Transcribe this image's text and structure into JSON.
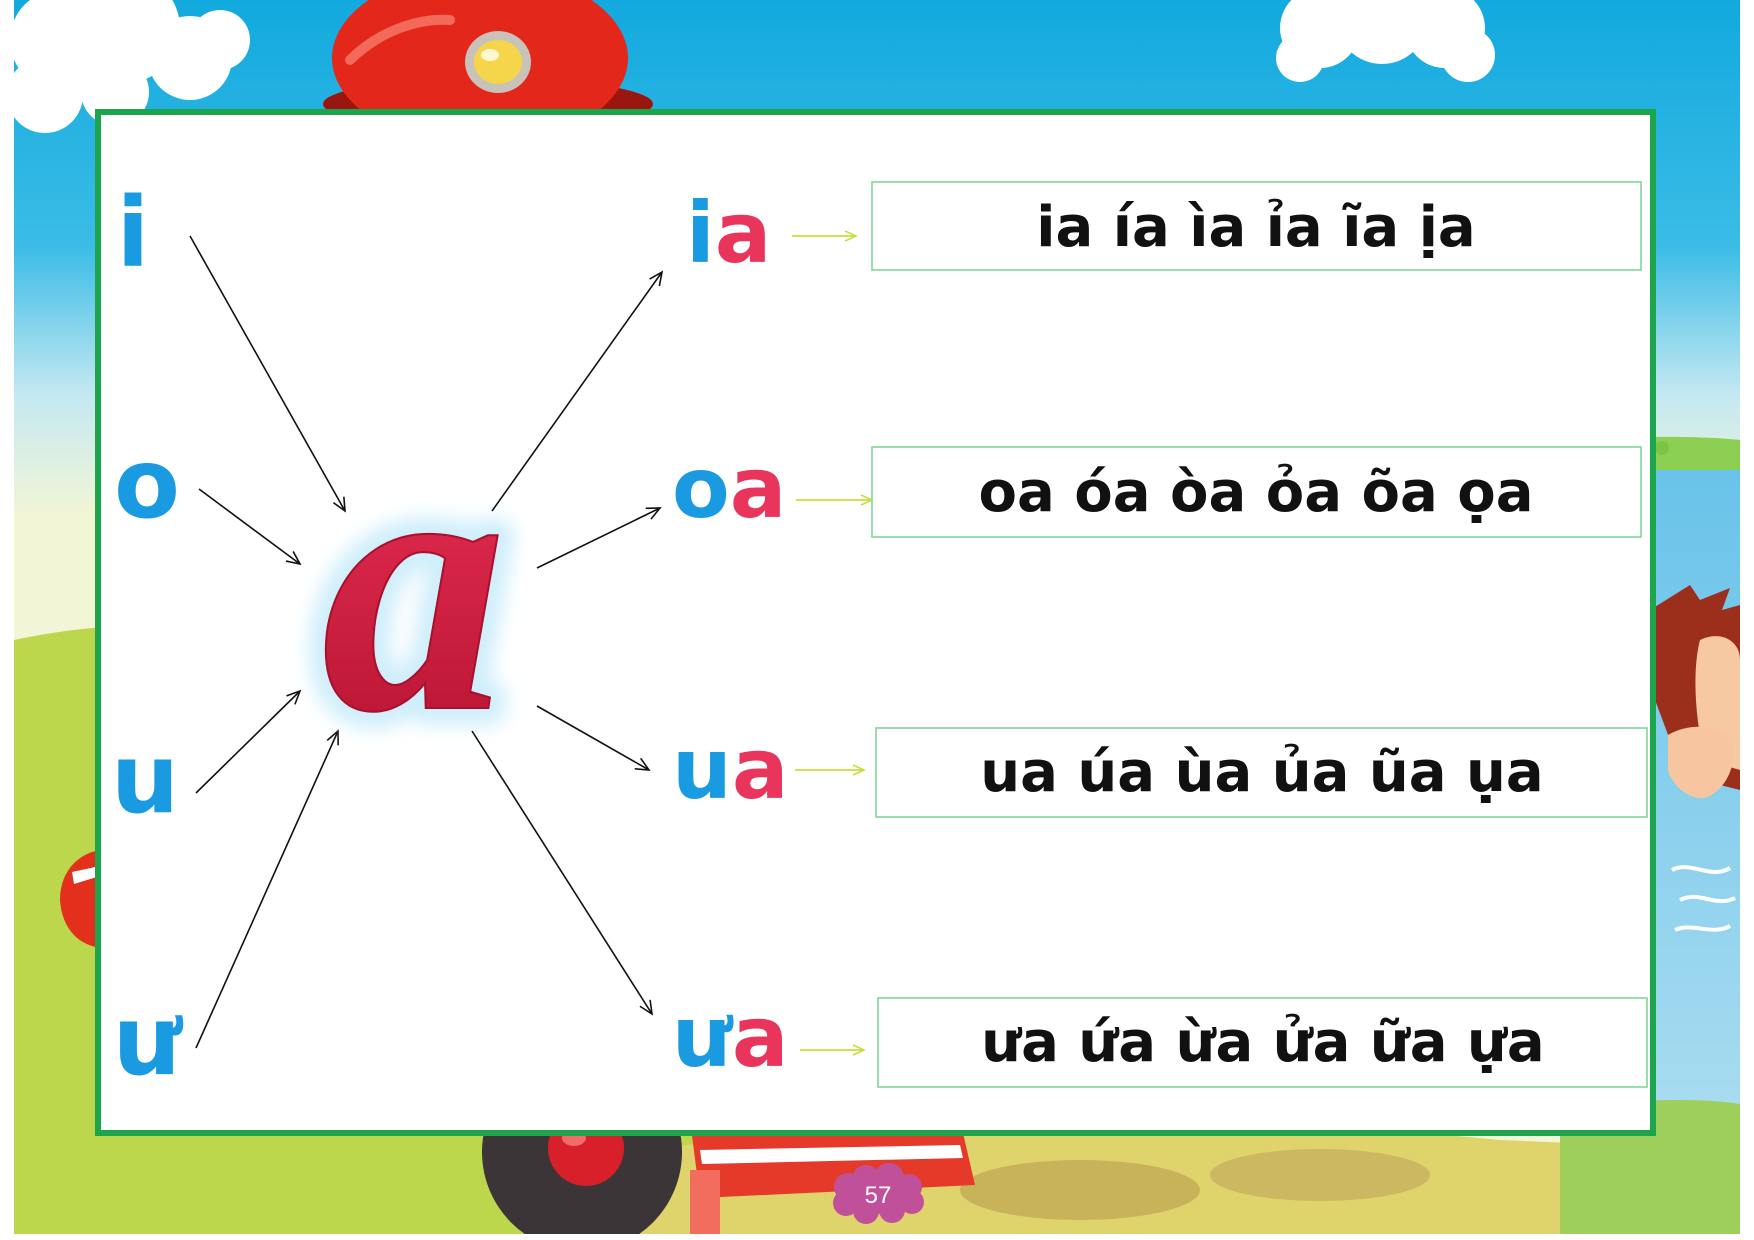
{
  "page_number": "57",
  "center_letter": "a",
  "vowels": [
    "i",
    "o",
    "u",
    "ư"
  ],
  "rhymes": [
    {
      "parts": [
        "i",
        "a"
      ],
      "tones": "ia ía ìa ỉa ĩa ịa"
    },
    {
      "parts": [
        "o",
        "a"
      ],
      "tones": "oa óa òa ỏa õa ọa"
    },
    {
      "parts": [
        "u",
        "a"
      ],
      "tones": "ua úa ùa ủa ũa ụa"
    },
    {
      "parts": [
        "ư",
        "a"
      ],
      "tones": "ưa ứa ừa ửa ữa ựa"
    }
  ],
  "colors": {
    "vowel_blue": "#1a9ae0",
    "a_red": "#e9345c",
    "panel_border": "#1ca54c",
    "box_border": "#7fd69b",
    "arrow_green": "#c8de3c"
  }
}
